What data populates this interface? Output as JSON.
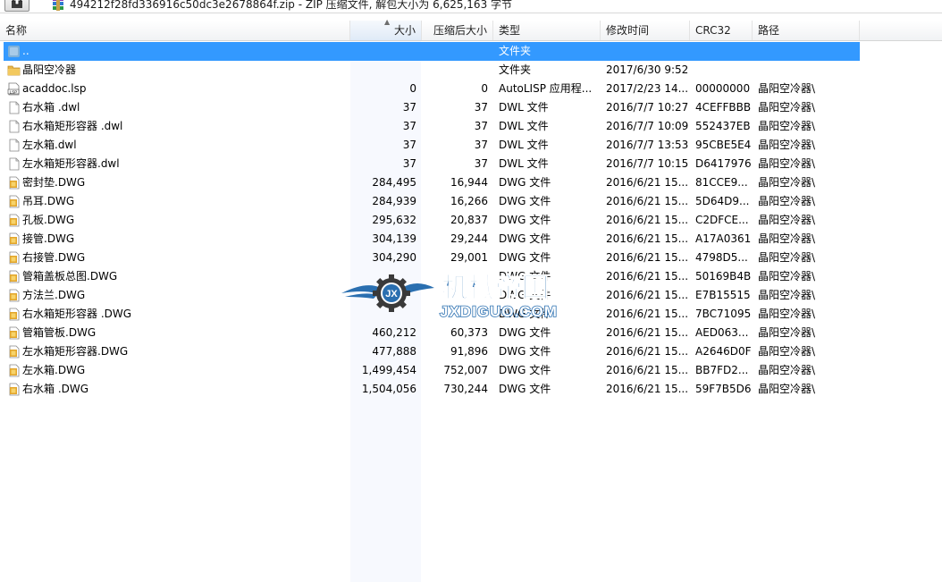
{
  "pathbar": {
    "up_icon": "up-folder-icon",
    "archive_icon": "winrar-archive-icon",
    "text": "494212f28fd336916c50dc3e2678864f.zip - ZIP 压缩文件, 解包大小为 6,625,163 字节"
  },
  "columns": {
    "name": "名称",
    "size": "大小",
    "packed": "压缩后大小",
    "type": "类型",
    "modified": "修改时间",
    "crc": "CRC32",
    "path": "路径"
  },
  "rows": [
    {
      "icon": "parent-folder",
      "name": "..",
      "size": "",
      "packed": "",
      "type": "文件夹",
      "modified": "",
      "crc": "",
      "path": "",
      "selected": true
    },
    {
      "icon": "folder",
      "name": "晶阳空冷器",
      "size": "",
      "packed": "",
      "type": "文件夹",
      "modified": "2017/6/30 9:52",
      "crc": "",
      "path": ""
    },
    {
      "icon": "lsp",
      "name": "acaddoc.lsp",
      "size": "0",
      "packed": "0",
      "type": "AutoLISP 应用程...",
      "modified": "2017/2/23 14...",
      "crc": "00000000",
      "path": "晶阳空冷器\\"
    },
    {
      "icon": "blank",
      "name": "右水箱 .dwl",
      "size": "37",
      "packed": "37",
      "type": "DWL 文件",
      "modified": "2016/7/7 10:27",
      "crc": "4CEFFBBB",
      "path": "晶阳空冷器\\"
    },
    {
      "icon": "blank",
      "name": "右水箱矩形容器 .dwl",
      "size": "37",
      "packed": "37",
      "type": "DWL 文件",
      "modified": "2016/7/7 10:09",
      "crc": "552437EB",
      "path": "晶阳空冷器\\"
    },
    {
      "icon": "blank",
      "name": "左水箱.dwl",
      "size": "37",
      "packed": "37",
      "type": "DWL 文件",
      "modified": "2016/7/7 13:53",
      "crc": "95CBE5E4",
      "path": "晶阳空冷器\\"
    },
    {
      "icon": "blank",
      "name": "左水箱矩形容器.dwl",
      "size": "37",
      "packed": "37",
      "type": "DWL 文件",
      "modified": "2016/7/7 10:15",
      "crc": "D6417976",
      "path": "晶阳空冷器\\"
    },
    {
      "icon": "dwg",
      "name": "密封垫.DWG",
      "size": "284,495",
      "packed": "16,944",
      "type": "DWG 文件",
      "modified": "2016/6/21 15...",
      "crc": "81CCE9...",
      "path": "晶阳空冷器\\"
    },
    {
      "icon": "dwg",
      "name": "吊耳.DWG",
      "size": "284,939",
      "packed": "16,266",
      "type": "DWG 文件",
      "modified": "2016/6/21 15...",
      "crc": "5D64D9...",
      "path": "晶阳空冷器\\"
    },
    {
      "icon": "dwg",
      "name": "孔板.DWG",
      "size": "295,632",
      "packed": "20,837",
      "type": "DWG 文件",
      "modified": "2016/6/21 15...",
      "crc": "C2DFCE...",
      "path": "晶阳空冷器\\"
    },
    {
      "icon": "dwg",
      "name": "接管.DWG",
      "size": "304,139",
      "packed": "29,244",
      "type": "DWG 文件",
      "modified": "2016/6/21 15...",
      "crc": "A17A0361",
      "path": "晶阳空冷器\\"
    },
    {
      "icon": "dwg",
      "name": "右接管.DWG",
      "size": "304,290",
      "packed": "29,001",
      "type": "DWG 文件",
      "modified": "2016/6/21 15...",
      "crc": "4798D5...",
      "path": "晶阳空冷器\\"
    },
    {
      "icon": "dwg",
      "name": "管箱盖板总图.DWG",
      "size": "",
      "packed": "",
      "type": "DWG 文件",
      "modified": "2016/6/21 15...",
      "crc": "50169B4B",
      "path": "晶阳空冷器\\"
    },
    {
      "icon": "dwg",
      "name": "方法兰.DWG",
      "size": "",
      "packed": "",
      "type": "DWG 文件",
      "modified": "2016/6/21 15...",
      "crc": "E7B15515",
      "path": "晶阳空冷器\\"
    },
    {
      "icon": "dwg",
      "name": "右水箱矩形容器 .DWG",
      "size": "",
      "packed": "",
      "type": "DWG 文件",
      "modified": "2016/6/21 15...",
      "crc": "7BC71095",
      "path": "晶阳空冷器\\"
    },
    {
      "icon": "dwg",
      "name": "管箱管板.DWG",
      "size": "460,212",
      "packed": "60,373",
      "type": "DWG 文件",
      "modified": "2016/6/21 15...",
      "crc": "AED063...",
      "path": "晶阳空冷器\\"
    },
    {
      "icon": "dwg",
      "name": "左水箱矩形容器.DWG",
      "size": "477,888",
      "packed": "91,896",
      "type": "DWG 文件",
      "modified": "2016/6/21 15...",
      "crc": "A2646D0F",
      "path": "晶阳空冷器\\"
    },
    {
      "icon": "dwg",
      "name": "左水箱.DWG",
      "size": "1,499,454",
      "packed": "752,007",
      "type": "DWG 文件",
      "modified": "2016/6/21 15...",
      "crc": "BB7FD2...",
      "path": "晶阳空冷器\\"
    },
    {
      "icon": "dwg",
      "name": "右水箱 .DWG",
      "size": "1,504,056",
      "packed": "730,244",
      "type": "DWG 文件",
      "modified": "2016/6/21 15...",
      "crc": "59F7B5D6",
      "path": "晶阳空冷器\\"
    }
  ],
  "watermark": {
    "icon": "jx-winged-gear-logo",
    "badge": "JX",
    "title": "机械帝国",
    "url": "JXDIGUO.COM"
  },
  "colors": {
    "selection": "#3399ff",
    "folder": "#e8b64a",
    "watermark_blue": "#2a6fb0"
  }
}
